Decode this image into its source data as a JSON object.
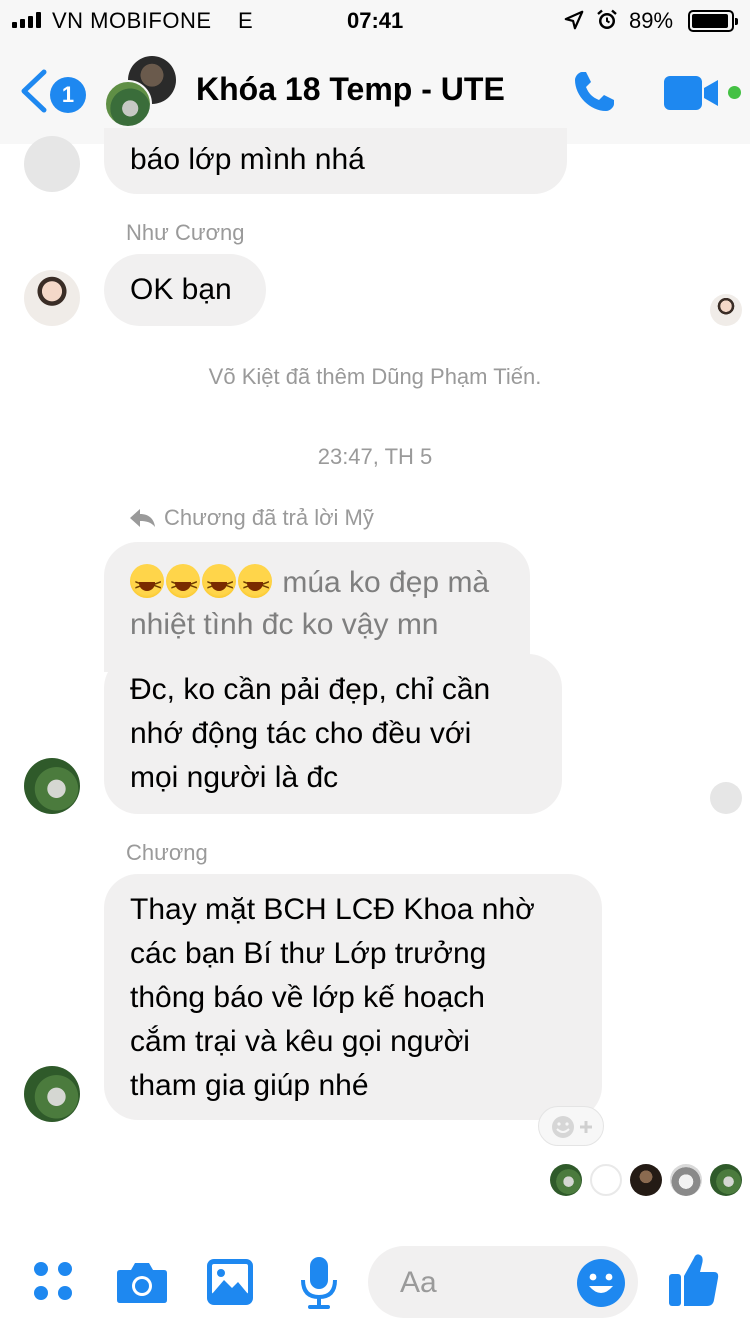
{
  "status_bar": {
    "carrier": "VN MOBIFONE",
    "network": "E",
    "time": "07:41",
    "battery_percent": "89%",
    "icons": [
      "signal-icon",
      "location-arrow-icon",
      "alarm-icon",
      "battery-icon"
    ]
  },
  "header": {
    "back_count": "1",
    "title": "Khóa 18 Temp - UTE",
    "icons": [
      "chevron-left-icon",
      "phone-icon",
      "video-camera-icon"
    ],
    "accent_color": "#1e88f0",
    "active_color": "#44c144"
  },
  "chat": {
    "messages": [
      {
        "type": "bubble",
        "text": "báo lớp mình nhá"
      },
      {
        "type": "sender",
        "text": "Như Cương"
      },
      {
        "type": "bubble",
        "text": "OK bạn"
      },
      {
        "type": "system",
        "text": "Võ Kiệt đã thêm Dũng Phạm Tiến."
      },
      {
        "type": "timestamp",
        "text": "23:47, TH 5"
      },
      {
        "type": "reply_tag",
        "text": "Chương đã trả lời Mỹ"
      },
      {
        "type": "quoted",
        "line1": "múa ko đẹp mà",
        "line2": "nhiệt tình đc ko vậy mn"
      },
      {
        "type": "bubble",
        "lines": [
          "Đc, ko cần pải đẹp, chỉ cần",
          "nhớ động tác cho đều với",
          "mọi người là đc"
        ]
      },
      {
        "type": "sender",
        "text": "Chương"
      },
      {
        "type": "bubble",
        "lines": [
          "Thay mặt BCH LCĐ Khoa nhờ",
          "các bạn Bí thư Lớp trưởng",
          "thông báo về lớp kế hoạch",
          "cắm trại và kêu gọi người",
          "tham gia giúp nhé"
        ]
      }
    ],
    "bubble_color": "#f1f0f0",
    "meta_text_color": "#9a9a9a"
  },
  "composer": {
    "placeholder": "Aa",
    "icons": [
      "apps-icon",
      "camera-icon",
      "photo-icon",
      "microphone-icon",
      "emoji-icon",
      "thumbs-up-icon"
    ]
  }
}
